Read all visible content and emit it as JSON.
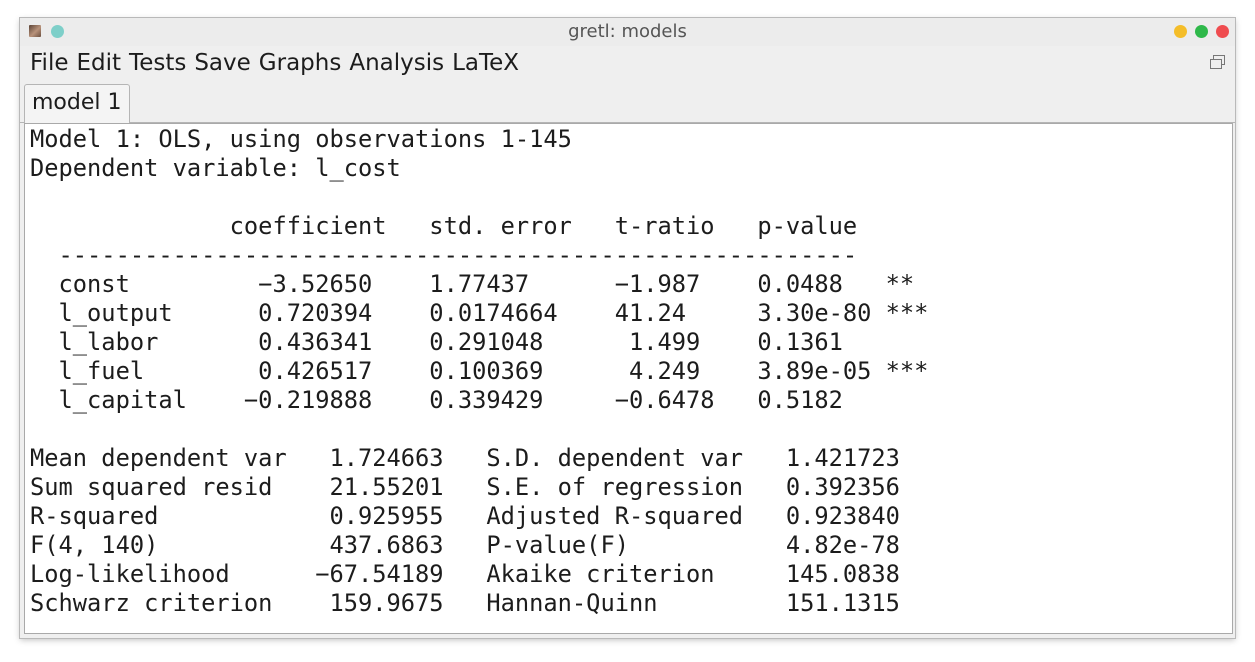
{
  "window": {
    "title": "gretl: models",
    "colors": {
      "minimize": "#f4bd29",
      "maximize": "#2eb84a",
      "close": "#ef4c4f",
      "title_dot": "#7ecfc9"
    }
  },
  "menu": {
    "items": [
      "File",
      "Edit",
      "Tests",
      "Save",
      "Graphs",
      "Analysis",
      "LaTeX"
    ]
  },
  "tabs": [
    {
      "label": "model 1",
      "active": true
    }
  ],
  "output": {
    "header_line1": "Model 1: OLS, using observations 1-145",
    "header_line2": "Dependent variable: l_cost",
    "columns": [
      "coefficient",
      "std. error",
      "t-ratio",
      "p-value"
    ],
    "separator": "--------------------------------------------------------",
    "coefficients": [
      {
        "name": "const",
        "coefficient": "−3.52650",
        "std_error": "1.77437",
        "t_ratio": "−1.987",
        "p_value": "0.0488",
        "stars": "**"
      },
      {
        "name": "l_output",
        "coefficient": "0.720394",
        "std_error": "0.0174664",
        "t_ratio": "41.24",
        "p_value": "3.30e-80",
        "stars": "***"
      },
      {
        "name": "l_labor",
        "coefficient": "0.436341",
        "std_error": "0.291048",
        "t_ratio": "1.499",
        "p_value": "0.1361",
        "stars": ""
      },
      {
        "name": "l_fuel",
        "coefficient": "0.426517",
        "std_error": "0.100369",
        "t_ratio": "4.249",
        "p_value": "3.89e-05",
        "stars": "***"
      },
      {
        "name": "l_capital",
        "coefficient": "−0.219888",
        "std_error": "0.339429",
        "t_ratio": "−0.6478",
        "p_value": "0.5182",
        "stars": ""
      }
    ],
    "statistics": [
      [
        {
          "label": "Mean dependent var",
          "value": "1.724663"
        },
        {
          "label": "S.D. dependent var",
          "value": "1.421723"
        }
      ],
      [
        {
          "label": "Sum squared resid",
          "value": "21.55201"
        },
        {
          "label": "S.E. of regression",
          "value": "0.392356"
        }
      ],
      [
        {
          "label": "R-squared",
          "value": "0.925955"
        },
        {
          "label": "Adjusted R-squared",
          "value": "0.923840"
        }
      ],
      [
        {
          "label": "F(4, 140)",
          "value": "437.6863"
        },
        {
          "label": "P-value(F)",
          "value": "4.82e-78"
        }
      ],
      [
        {
          "label": "Log-likelihood",
          "value": "−67.54189"
        },
        {
          "label": "Akaike criterion",
          "value": "145.0838"
        }
      ],
      [
        {
          "label": "Schwarz criterion",
          "value": "159.9675"
        },
        {
          "label": "Hannan-Quinn",
          "value": "151.1315"
        }
      ]
    ]
  }
}
